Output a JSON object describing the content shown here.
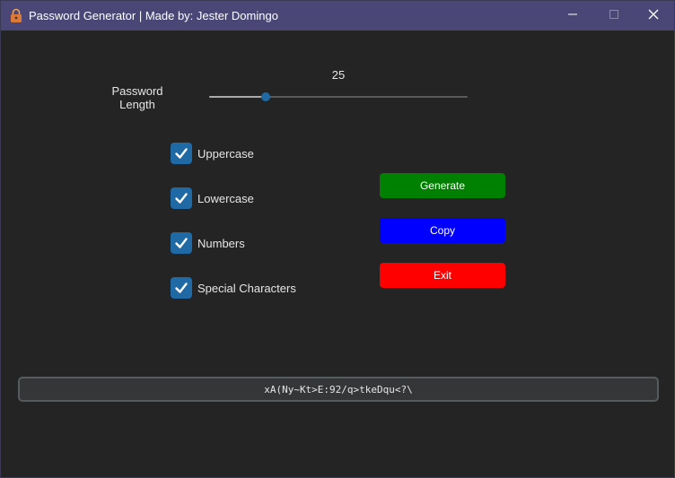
{
  "window": {
    "title": "Password Generator | Made by: Jester Domingo",
    "title_icon": "lock-icon",
    "controls": {
      "minimize_icon": "minimize-icon",
      "maximize_icon": "maximize-icon",
      "close_icon": "close-icon"
    },
    "titlebar_color": "#4a4776"
  },
  "length": {
    "label": "Password\nLength",
    "value": "25",
    "slider_fraction": 0.22,
    "accent_color": "#1f6aa5"
  },
  "options": [
    {
      "label": "Uppercase",
      "checked": true
    },
    {
      "label": "Lowercase",
      "checked": true
    },
    {
      "label": "Numbers",
      "checked": true
    },
    {
      "label": "Special Characters",
      "checked": true
    }
  ],
  "buttons": {
    "generate": {
      "label": "Generate",
      "color": "#008000"
    },
    "copy": {
      "label": "Copy",
      "color": "#0000ff"
    },
    "exit": {
      "label": "Exit",
      "color": "#ff0000"
    }
  },
  "output": {
    "password": "xA(Ny~Kt>E:92/q>tkeDqu<?\\"
  }
}
